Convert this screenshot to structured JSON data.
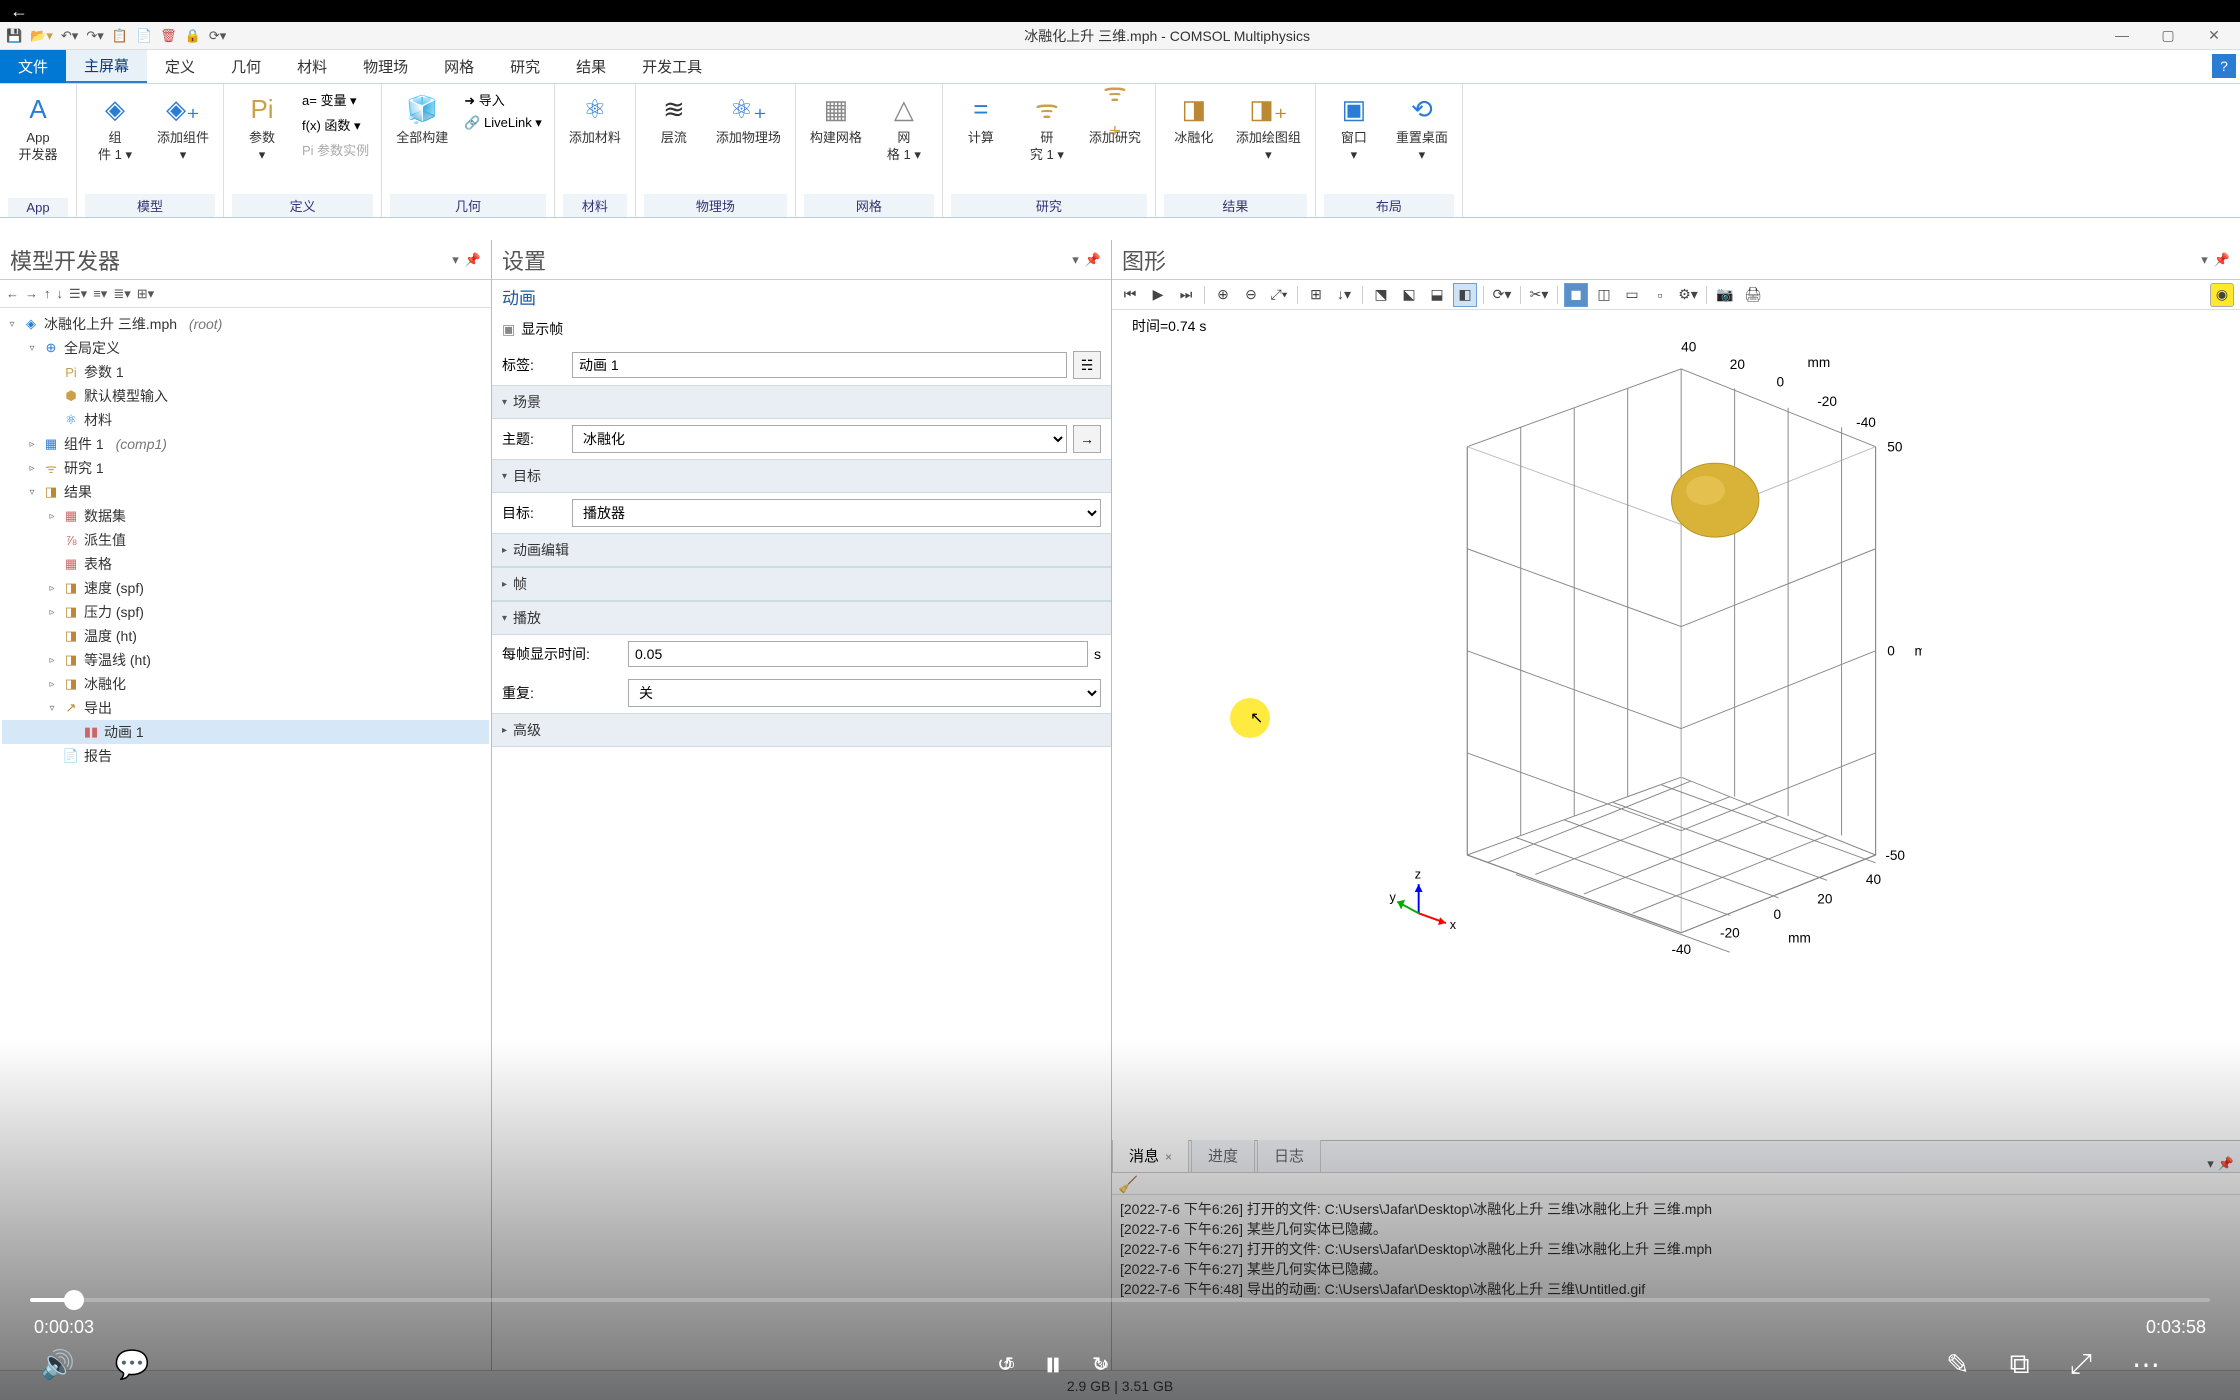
{
  "video": {
    "elapsed": "0:00:03",
    "remain": "0:03:58"
  },
  "title": "冰融化上升 三维.mph - COMSOL Multiphysics",
  "menu": {
    "file": "文件",
    "home": "主屏幕",
    "def": "定义",
    "geo": "几何",
    "mat": "材料",
    "phys": "物理场",
    "mesh": "网格",
    "study": "研究",
    "res": "结果",
    "dev": "开发工具"
  },
  "ribbon": {
    "app": "App",
    "groups": {
      "app": "App",
      "model": "模型",
      "def": "定义",
      "geo": "几何",
      "mat": "材料",
      "phys": "物理场",
      "mesh": "网格",
      "study": "研究",
      "res": "结果",
      "layout": "布局"
    },
    "btns": {
      "app_dev": "App\n开发器",
      "comp1": "组\n件 1 ▾",
      "add_comp": "添加组件\n▾",
      "pi": "Pi",
      "params": "参数\n▾",
      "var": "a= 变量 ▾",
      "func": "f(x) 函数 ▾",
      "param_case": "Pi 参数实例",
      "build_all": "全部构建",
      "import": "➜ 导入",
      "livelink": "🔗 LiveLink ▾",
      "add_mat": "添加材料",
      "laminar": "层流",
      "add_phys": "添加物理场",
      "build_mesh": "构建网格",
      "mesh1": "网\n格 1 ▾",
      "compute": "计算",
      "study1": "研\n究 1 ▾",
      "add_study": "添加研究",
      "ice": "冰融化",
      "add_plot": "添加绘图组\n▾",
      "window": "窗口\n▾",
      "reset": "重置桌面\n▾"
    }
  },
  "model_dev": {
    "title": "模型开发器",
    "root": "冰融化上升 三维.mph",
    "root_suffix": "(root)",
    "global_def": "全局定义",
    "params1": "参数 1",
    "default_input": "默认模型输入",
    "materials": "材料",
    "comp1": "组件 1",
    "comp1_suffix": "(comp1)",
    "study1": "研究 1",
    "results": "结果",
    "datasets": "数据集",
    "derived": "派生值",
    "tables": "表格",
    "vel": "速度 (spf)",
    "pres": "压力 (spf)",
    "temp": "温度 (ht)",
    "iso": "等温线 (ht)",
    "ice": "冰融化",
    "export": "导出",
    "anim1": "动画 1",
    "report": "报告"
  },
  "settings": {
    "title": "设置",
    "anim": "动画",
    "show_frame": "显示帧",
    "label_lbl": "标签:",
    "label_val": "动画 1",
    "scene": "场景",
    "subject_lbl": "主题:",
    "subject_val": "冰融化",
    "target": "目标",
    "target_lbl": "目标:",
    "target_val": "播放器",
    "anim_edit": "动画编辑",
    "frame": "帧",
    "play": "播放",
    "frame_time_lbl": "每帧显示时间:",
    "frame_time_val": "0.05",
    "frame_time_unit": "s",
    "repeat_lbl": "重复:",
    "repeat_val": "关",
    "advanced": "高级"
  },
  "graphics": {
    "title": "图形",
    "time_label": "时间=0.74 s",
    "axis_ticks": {
      "top": [
        "40",
        "20",
        "0",
        "-20",
        "-40"
      ],
      "top_unit": "mm",
      "right_z": [
        "50",
        "0",
        "-50"
      ],
      "right_unit": "mm",
      "bottom_y": [
        "40",
        "20",
        "0",
        "-20",
        "-40"
      ],
      "bottom_unit": "mm"
    },
    "axes_labels": {
      "x": "x",
      "y": "y",
      "z": "z"
    }
  },
  "msgs": {
    "tabs": {
      "msg": "消息",
      "prog": "进度",
      "log": "日志"
    },
    "lines": [
      "[2022-7-6 下午6:26] 打开的文件: C:\\Users\\Jafar\\Desktop\\冰融化上升 三维\\冰融化上升 三维.mph",
      "[2022-7-6 下午6:26] 某些几何实体已隐藏。",
      "[2022-7-6 下午6:27] 打开的文件: C:\\Users\\Jafar\\Desktop\\冰融化上升 三维\\冰融化上升 三维.mph",
      "[2022-7-6 下午6:27] 某些几何实体已隐藏。",
      "[2022-7-6 下午6:48] 导出的动画: C:\\Users\\Jafar\\Desktop\\冰融化上升 三维\\Untitled.gif"
    ]
  },
  "status": "2.9 GB | 3.51 GB"
}
